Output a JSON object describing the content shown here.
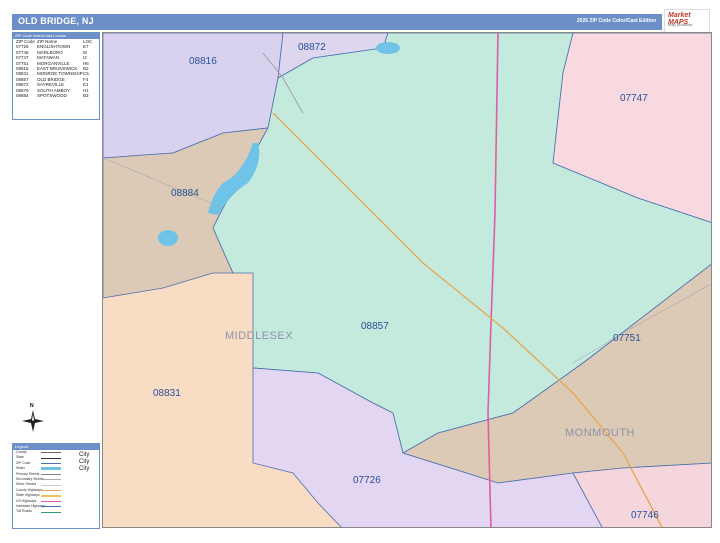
{
  "header": {
    "title": "OLD BRIDGE, NJ",
    "edition": "2026 ZIP Code Color/Cast Edition"
  },
  "logo": {
    "name": "Market MAPS",
    "sub": "map products"
  },
  "index": {
    "title": "ZIP Code Index/Cast Locator",
    "columns": [
      "ZIP Code",
      "ZIP Name",
      "LOC"
    ],
    "rows": [
      {
        "zip": "07726",
        "name": "ENGLISHTOWN",
        "loc": "E7"
      },
      {
        "zip": "07746",
        "name": "MARLBORO",
        "loc": "I8"
      },
      {
        "zip": "07747",
        "name": "MATAWAN",
        "loc": "I2"
      },
      {
        "zip": "07751",
        "name": "MORGANVILLE",
        "loc": "H6"
      },
      {
        "zip": "08816",
        "name": "EAST BRUNSWICK",
        "loc": "B2"
      },
      {
        "zip": "08831",
        "name": "MONROE TOWNSHIP",
        "loc": "C5"
      },
      {
        "zip": "08857",
        "name": "OLD BRIDGE",
        "loc": "F4"
      },
      {
        "zip": "08872",
        "name": "SAYREVILLE",
        "loc": "E1"
      },
      {
        "zip": "08879",
        "name": "SOUTH AMBOY",
        "loc": "H1"
      },
      {
        "zip": "08884",
        "name": "SPOTSWOOD",
        "loc": "B3"
      }
    ]
  },
  "zip_labels": [
    "08872",
    "08816",
    "07747",
    "08884",
    "08857",
    "07751",
    "08831",
    "07726",
    "07746"
  ],
  "counties": [
    "MIDDLESEX",
    "MONMOUTH"
  ],
  "legend": {
    "title": "Legend",
    "rows": [
      "County",
      "State",
      "ZIP Code",
      "Water",
      "Primary Streets",
      "Secondary Streets",
      "Minor Streets",
      "County Highways",
      "State Highways",
      "US Highways",
      "Interstate Highways",
      "Toll Roads"
    ],
    "city_labels": [
      "City",
      "City",
      "City"
    ]
  },
  "compass": {
    "north": "N"
  },
  "colors": {
    "header": "#6d8fc7",
    "zip_text": "#27509a",
    "region_08857": "#c3eadc",
    "region_08872": "#ddd6ee",
    "region_08816": "#d9d2ee",
    "region_07747": "#f7d9df",
    "region_08884": "#dccab6",
    "region_07751": "#dccab6",
    "region_08831": "#f8dcc4",
    "region_07726": "#e3d6f2",
    "region_07746": "#f4d6dc",
    "water": "#6fc3e8",
    "boundary": "#4b6fb0",
    "highway_pink": "#e05ca3",
    "highway_orange": "#e6a858"
  }
}
